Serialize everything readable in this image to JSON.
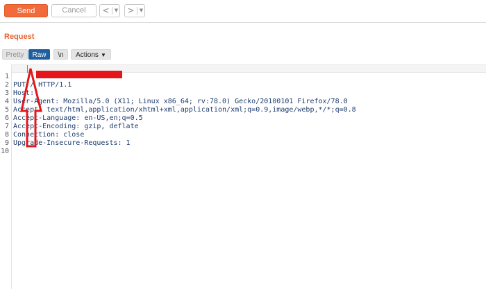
{
  "toolbar": {
    "send_label": "Send",
    "cancel_label": "Cancel",
    "back_glyph": "<",
    "forward_glyph": ">",
    "dropdown_glyph": "▼"
  },
  "request": {
    "title": "Request",
    "tabs": {
      "pretty": "Pretty",
      "raw": "Raw",
      "newline": "\\n",
      "actions": "Actions"
    },
    "active_tab": "Raw"
  },
  "editor": {
    "lines": [
      {
        "n": "1",
        "text": "PUT / HTTP/1.1"
      },
      {
        "n": "2",
        "text": "Host:"
      },
      {
        "n": "3",
        "text": "User-Agent: Mozilla/5.0 (X11; Linux x86_64; rv:78.0) Gecko/20100101 Firefox/78.0"
      },
      {
        "n": "4",
        "text": "Accept: text/html,application/xhtml+xml,application/xml;q=0.9,image/webp,*/*;q=0.8"
      },
      {
        "n": "5",
        "text": "Accept-Language: en-US,en;q=0.5"
      },
      {
        "n": "6",
        "text": "Accept-Encoding: gzip, deflate"
      },
      {
        "n": "7",
        "text": "Connection: close"
      },
      {
        "n": "8",
        "text": "Upgrade-Insecure-Requests: 1"
      },
      {
        "n": "9",
        "text": ""
      },
      {
        "n": "10",
        "text": ""
      }
    ]
  },
  "colors": {
    "accent": "#f26b3a",
    "active_tab": "#1f5f9e",
    "annotation": "#e3171b",
    "code_text": "#1e3d6e"
  },
  "icons": {
    "chevron": "chevron-down-icon",
    "back": "arrow-left-icon",
    "forward": "arrow-right-icon"
  }
}
